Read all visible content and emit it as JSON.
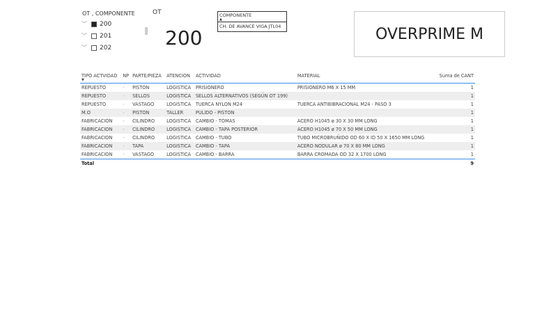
{
  "slicer": {
    "title": "OT , COMPONENTE",
    "items": [
      {
        "label": "200",
        "checked": true
      },
      {
        "label": "201",
        "checked": false
      },
      {
        "label": "202",
        "checked": false
      }
    ]
  },
  "card": {
    "title": "OT",
    "value": "200"
  },
  "componente": {
    "header": "COMPONENTE",
    "value": "CH. DE AVANCE VIGA JTL04"
  },
  "brand": "OVERPRIME M",
  "table": {
    "headers": [
      "TIPO ACTVIDAD",
      "NP",
      "PARTE/PIEZA",
      "ATENCION",
      "ACTIVIDAD",
      "MATERIAL",
      "Suma de CANT"
    ],
    "rows": [
      [
        "REPUESTO",
        "-",
        "PISTON",
        "LOGISTICA",
        "PRISIONERO",
        "PRISIONERO M6 X 15 MM",
        "1"
      ],
      [
        "REPUESTO",
        "-",
        "SELLOS",
        "LOGISTICA",
        "SELLOS ALTERNATIVOS (SEGÚN OT 199)",
        "",
        "1"
      ],
      [
        "REPUESTO",
        "-",
        "VASTAGO",
        "LOGISTICA",
        "TUERCA NYLON M24",
        "TUERCA ANTIBIBRACIONAL M24 - PASO 3",
        "1"
      ],
      [
        "M.O",
        "-",
        "PISTON",
        "TALLER",
        "PULIDO - PISTON",
        "",
        "1"
      ],
      [
        "FABRICACION",
        "-",
        "CILINDRO",
        "LOGISTICA",
        "CAMBIO - TOMAS",
        "ACERO H1045 ø 30 X 30 MM LONG",
        "1"
      ],
      [
        "FABRICACION",
        "-",
        "CILINDRO",
        "LOGISTICA",
        "CAMBIO - TAPA POSTERIOR",
        "ACERO H1045 ø 70 X 50 MM LONG",
        "1"
      ],
      [
        "FABRICACION",
        "-",
        "CILINDRO",
        "LOGISTICA",
        "CAMBIO - TUBO",
        "TUBO MICROBRUÑIDO OD 60 X ID 50 X 1650 MM LONG",
        "1"
      ],
      [
        "FABRICACION",
        "-",
        "TAPA",
        "LOGISTICA",
        "CAMBIO - TAPA",
        "ACERO NODULAR ø 70 X 80 MM LONG",
        "1"
      ],
      [
        "FABRICACION",
        "-",
        "VASTAGO",
        "LOGISTICA",
        "CAMBIO - BARRA",
        "BARRA CROMADA OD 32 X 1700 LONG",
        "1"
      ]
    ],
    "total_label": "Total",
    "total_value": "9"
  }
}
